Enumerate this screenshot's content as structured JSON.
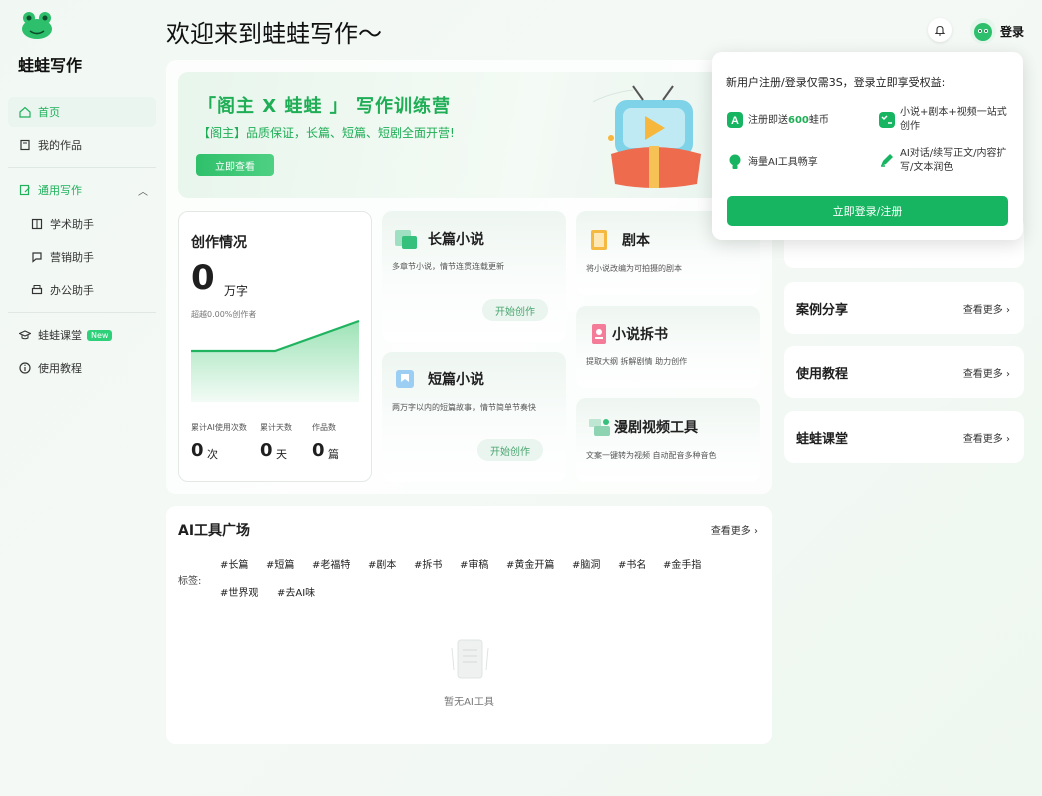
{
  "brand": {
    "name": "蛙蛙写作"
  },
  "header": {
    "title": "欢迎来到蛙蛙写作～",
    "login_label": "登录"
  },
  "sidebar": {
    "items": [
      {
        "label": "首页",
        "icon": "home-icon",
        "active": true
      },
      {
        "label": "我的作品",
        "icon": "book-icon"
      },
      {
        "label": "通用写作",
        "icon": "edit-icon",
        "active": true
      },
      {
        "label": "学术助手",
        "icon": "academic-icon"
      },
      {
        "label": "营销助手",
        "icon": "chat-icon"
      },
      {
        "label": "办公助手",
        "icon": "printer-icon"
      },
      {
        "label": "蛙蛙课堂",
        "icon": "graduation-icon",
        "badge": "New"
      },
      {
        "label": "使用教程",
        "icon": "info-icon"
      }
    ]
  },
  "banner": {
    "title": "「阁主 X 蛙蛙 」 写作训练营",
    "subtitle": "【阁主】品质保证，长篇、短篇、短剧全面开营!",
    "button": "立即查看"
  },
  "stats": {
    "title": "创作情况",
    "words_value": "0",
    "words_unit": "万字",
    "percent_text": "超越0.00%创作者",
    "items": [
      {
        "label": "累计AI使用次数",
        "value": "0",
        "unit": "次"
      },
      {
        "label": "累计天数",
        "value": "0",
        "unit": "天"
      },
      {
        "label": "作品数",
        "value": "0",
        "unit": "篇"
      }
    ]
  },
  "tools": {
    "long_novel": {
      "title": "长篇小说",
      "desc": "多章节小说，情节连贯连载更新",
      "button": "开始创作"
    },
    "short_story": {
      "title": "短篇小说",
      "desc": "两万字以内的短篇故事，情节简单节奏快",
      "button": "开始创作"
    },
    "script": {
      "title": "剧本",
      "desc": "将小说改编为可拍摄的剧本"
    },
    "novel_breakdown": {
      "title": "小说拆书",
      "desc": "提取大纲 拆解剧情 助力创作"
    },
    "comic_video": {
      "title": "漫剧视频工具",
      "desc": "文案一键转为视频 自动配音多种音色"
    }
  },
  "ai_tools": {
    "title": "AI工具广场",
    "more": "查看更多",
    "tag_label": "标签:",
    "tags": [
      "#长篇",
      "#短篇",
      "#老福特",
      "#剧本",
      "#拆书",
      "#审稿",
      "#黄金开篇",
      "#脑洞",
      "#书名",
      "#金手指",
      "#世界观",
      "#去AI味"
    ],
    "empty_text": "暂无AI工具"
  },
  "right_cards": [
    {
      "title": "案例分享",
      "more": "查看更多"
    },
    {
      "title": "使用教程",
      "more": "查看更多"
    },
    {
      "title": "蛙蛙课堂",
      "more": "查看更多"
    }
  ],
  "popup": {
    "headline": "新用户注册/登录仅需3S，登录立即享受权益:",
    "feature1_pre": "注册即送",
    "feature1_highlight": "600",
    "feature1_post": "蛙币",
    "feature2": "小说+剧本+视频一站式创作",
    "feature3": "海量AI工具畅享",
    "feature4": "AI对话/续写正文/内容扩写/文本润色",
    "button": "立即登录/注册"
  },
  "colors": {
    "accent": "#1fb15b",
    "button": "#17b561"
  }
}
